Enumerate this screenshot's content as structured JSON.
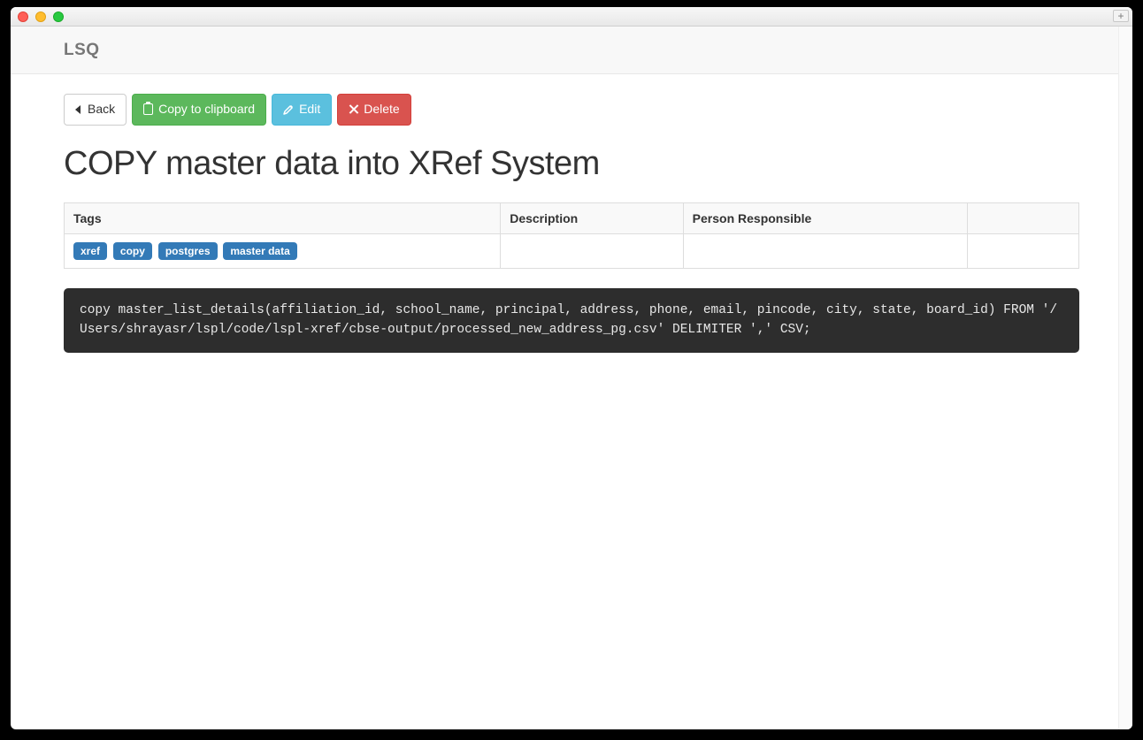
{
  "brand": "LSQ",
  "buttons": {
    "back": "Back",
    "copy": "Copy to clipboard",
    "edit": "Edit",
    "delete": "Delete"
  },
  "page_title": "COPY master data into XRef System",
  "table": {
    "headers": {
      "tags": "Tags",
      "description": "Description",
      "person": "Person Responsible"
    },
    "row": {
      "tags": [
        "xref",
        "copy",
        "postgres",
        "master data"
      ],
      "description": "",
      "person": ""
    }
  },
  "code": "copy master_list_details(affiliation_id, school_name, principal, address, phone, email, pincode, city, state, board_id) FROM '/Users/shrayasr/lspl/code/lspl-xref/cbse-output/processed_new_address_pg.csv' DELIMITER ',' CSV;"
}
